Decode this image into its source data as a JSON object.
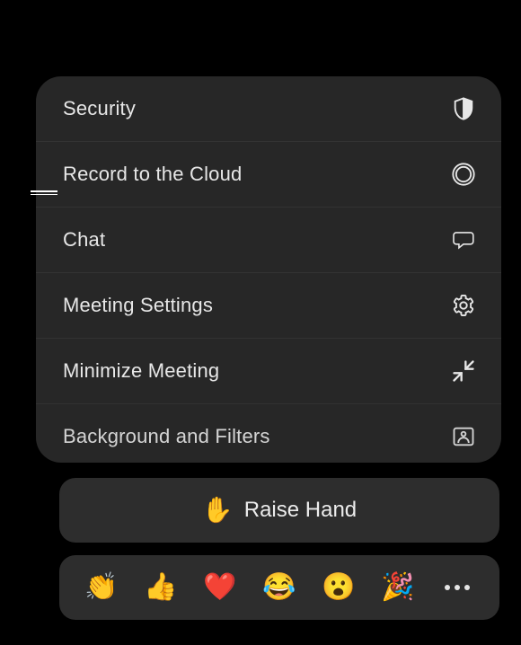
{
  "menu": {
    "items": [
      {
        "label": "Security",
        "icon": "shield-icon"
      },
      {
        "label": "Record to the Cloud",
        "icon": "record-icon"
      },
      {
        "label": "Chat",
        "icon": "chat-icon"
      },
      {
        "label": "Meeting Settings",
        "icon": "gear-icon"
      },
      {
        "label": "Minimize Meeting",
        "icon": "minimize-icon"
      },
      {
        "label": "Background and Filters",
        "icon": "background-icon"
      }
    ]
  },
  "raiseHand": {
    "emoji": "✋",
    "label": "Raise Hand"
  },
  "reactions": {
    "items": [
      {
        "emoji": "👏",
        "name": "clap"
      },
      {
        "emoji": "👍",
        "name": "thumbs-up"
      },
      {
        "emoji": "❤️",
        "name": "heart"
      },
      {
        "emoji": "😂",
        "name": "laugh"
      },
      {
        "emoji": "😮",
        "name": "wow"
      },
      {
        "emoji": "🎉",
        "name": "party"
      }
    ]
  }
}
